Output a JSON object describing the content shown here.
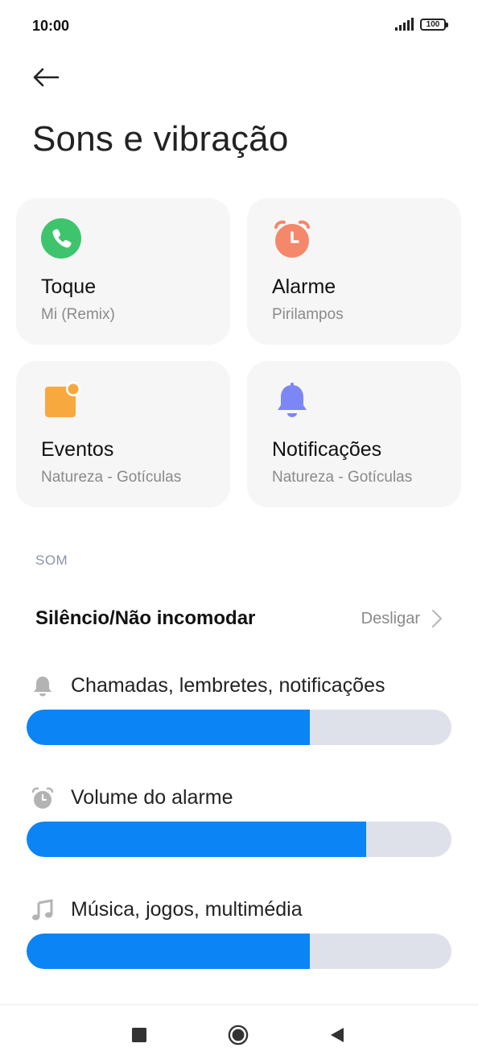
{
  "status_bar": {
    "time": "10:00",
    "battery": "100"
  },
  "header": {
    "title": "Sons e vibração"
  },
  "cards": [
    {
      "title": "Toque",
      "subtitle": "Mi (Remix)",
      "icon": "phone-icon",
      "color": "#3ec46d"
    },
    {
      "title": "Alarme",
      "subtitle": "Pirilampos",
      "icon": "alarm-clock-icon",
      "color": "#f5886a"
    },
    {
      "title": "Eventos",
      "subtitle": "Natureza - Gotículas",
      "icon": "calendar-event-icon",
      "color": "#f7a93f"
    },
    {
      "title": "Notificações",
      "subtitle": "Natureza - Gotículas",
      "icon": "bell-icon",
      "color": "#7d86f5"
    }
  ],
  "sound_section": {
    "label": "SOM",
    "dnd": {
      "title": "Silêncio/Não incomodar",
      "value": "Desligar"
    },
    "volumes": [
      {
        "label": "Chamadas, lembretes, notificações",
        "icon": "bell-icon",
        "level": 0.667
      },
      {
        "label": "Volume do alarme",
        "icon": "alarm-clock-icon",
        "level": 0.8
      },
      {
        "label": "Música, jogos, multimédia",
        "icon": "music-note-icon",
        "level": 0.667
      }
    ]
  },
  "colors": {
    "accent": "#0b84f5",
    "track": "#dfe1ea",
    "card_bg": "#f6f6f6"
  }
}
